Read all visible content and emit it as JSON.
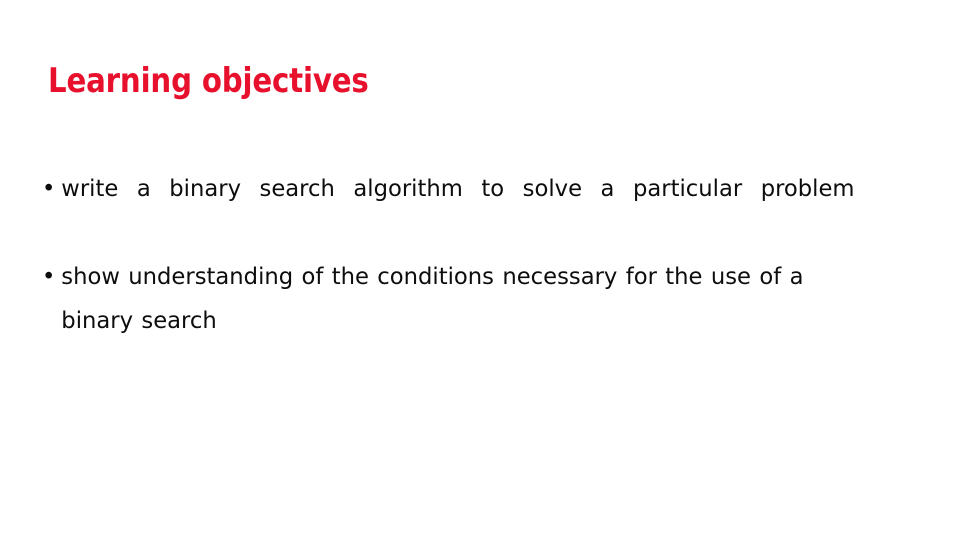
{
  "slide": {
    "background_color": "#ffffff",
    "title": "Learning objectives",
    "title_color": "#e8112d",
    "body_color": "#0d0d0d",
    "bullet_glyph": "•",
    "bullets": [
      {
        "text": "write a binary search algorithm to solve a particular problem",
        "alignment": "justify"
      },
      {
        "text": "show understanding of the conditions necessary for the use of a binary search",
        "alignment": "justify"
      }
    ]
  }
}
